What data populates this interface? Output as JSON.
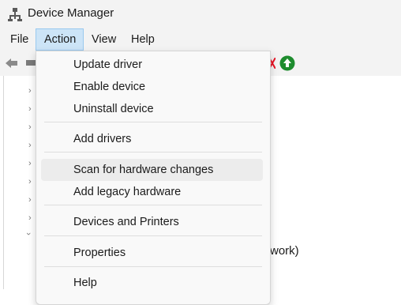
{
  "window": {
    "title": "Device Manager"
  },
  "menubar": {
    "items": [
      {
        "label": "File"
      },
      {
        "label": "Action"
      },
      {
        "label": "View"
      },
      {
        "label": "Help"
      }
    ]
  },
  "toolbar": {
    "icons": [
      "back-arrow-icon",
      "device-icon",
      "remove-device-icon",
      "update-driver-icon"
    ]
  },
  "action_menu": {
    "items": [
      {
        "label": "Update driver"
      },
      {
        "label": "Enable device"
      },
      {
        "label": "Uninstall device"
      },
      {
        "label": "Add drivers"
      },
      {
        "label": "Scan for hardware changes"
      },
      {
        "label": "Add legacy hardware"
      },
      {
        "label": "Devices and Printers"
      },
      {
        "label": "Properties"
      },
      {
        "label": "Help"
      }
    ]
  },
  "tree": {
    "visible_partial_text": "work)"
  },
  "colors": {
    "menu_active_bg": "#cce4f7",
    "menu_hover_bg": "#ececec",
    "update_icon_green": "#1e8c2e",
    "remove_icon_red": "#e81123"
  }
}
